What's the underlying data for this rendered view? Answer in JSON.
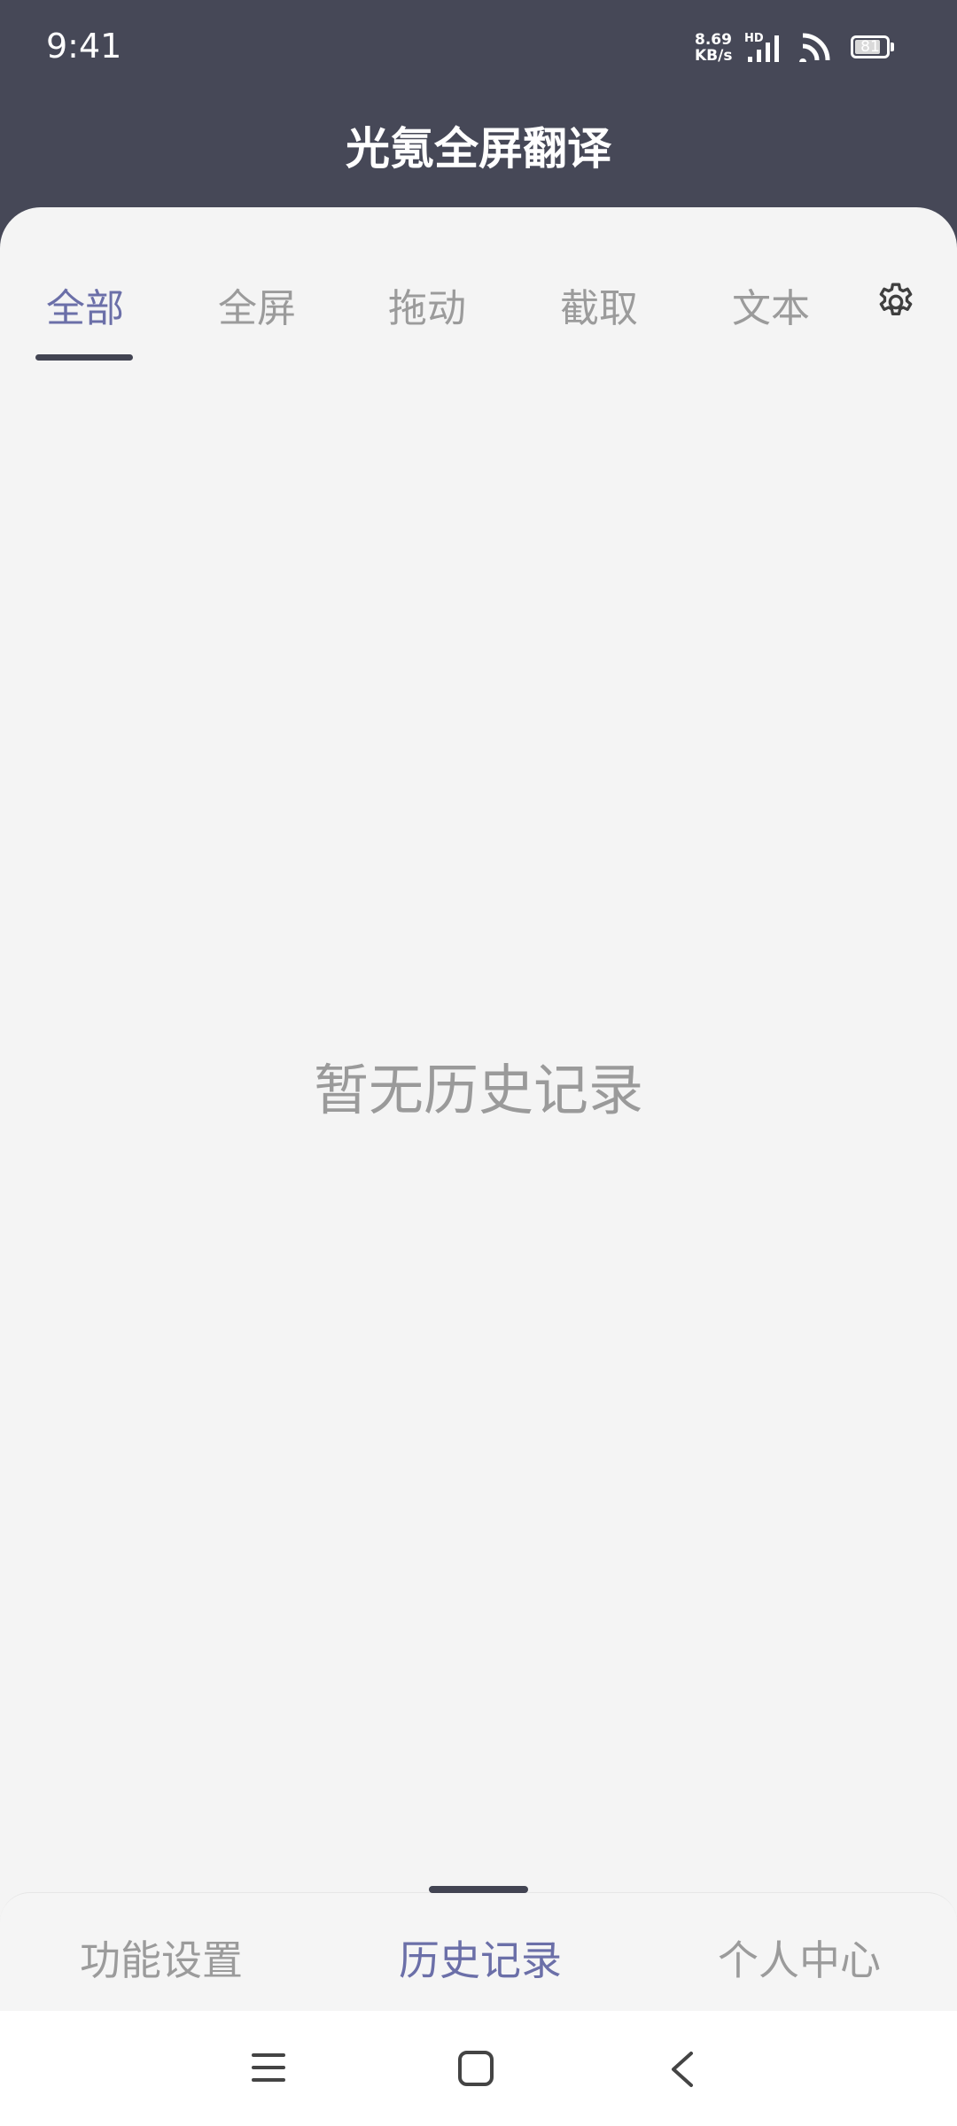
{
  "status": {
    "time": "9:41",
    "net_speed": "8.69",
    "net_unit": "KB/s",
    "hd": "HD",
    "battery": "81",
    "battery_level": 0.81
  },
  "app": {
    "title": "光氪全屏翻译"
  },
  "tabs": [
    {
      "label": "全部",
      "active": true
    },
    {
      "label": "全屏"
    },
    {
      "label": "拖动"
    },
    {
      "label": "截取"
    },
    {
      "label": "文本"
    }
  ],
  "empty_state": {
    "message": "暂无历史记录"
  },
  "bottom_nav": [
    {
      "label": "功能设置"
    },
    {
      "label": "历史记录",
      "active": true
    },
    {
      "label": "个人中心"
    }
  ],
  "icons": {
    "settings": "gear-icon",
    "menu": "menu-icon",
    "home": "home-icon",
    "back": "back-icon"
  },
  "colors": {
    "header_bg": "#464857",
    "accent": "#6b6fa8",
    "inactive": "#9b9b9b",
    "content_bg": "#f4f4f4"
  }
}
